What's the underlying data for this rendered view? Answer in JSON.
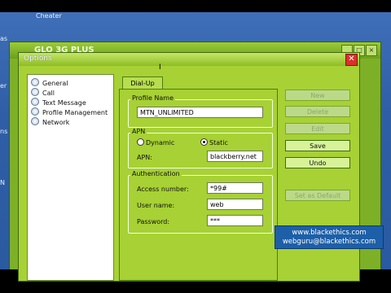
{
  "desktop": {
    "top_text": "Сheater",
    "left_icon_labels": [
      "as",
      "er",
      "ns",
      "N"
    ]
  },
  "back_window": {
    "title": "GLO 3G PLUS",
    "controls": [
      "_",
      "□",
      "×"
    ]
  },
  "dialog": {
    "title": "Options",
    "close_label": "✕"
  },
  "nav": {
    "items": [
      {
        "label": "General",
        "icon": "setting-icon"
      },
      {
        "label": "Call",
        "icon": "setting-icon"
      },
      {
        "label": "Text Message",
        "icon": "setting-icon"
      },
      {
        "label": "Profile Management",
        "icon": "setting-icon"
      },
      {
        "label": "Network",
        "icon": "setting-icon"
      }
    ]
  },
  "tab": {
    "label": "Dial-Up"
  },
  "profile": {
    "group_title": "Profile Name",
    "name_value": "MTN_UNLIMITED"
  },
  "apn": {
    "group_title": "APN",
    "dynamic_label": "Dynamic",
    "static_label": "Static",
    "selected": "Static",
    "apn_label": "APN:",
    "apn_value": "blackberry.net"
  },
  "auth": {
    "group_title": "Authentication",
    "access_label": "Access number:",
    "access_value": "*99#",
    "user_label": "User name:",
    "user_value": "web",
    "password_label": "Password:",
    "password_value": "***"
  },
  "buttons": {
    "new": "New",
    "delete": "Delete",
    "edit": "Edit",
    "save": "Save",
    "undo": "Undo",
    "set_default": "Set as Default"
  },
  "watermark": {
    "line1": "www.blackethics.com",
    "line2": "webguru@blackethics.com"
  }
}
